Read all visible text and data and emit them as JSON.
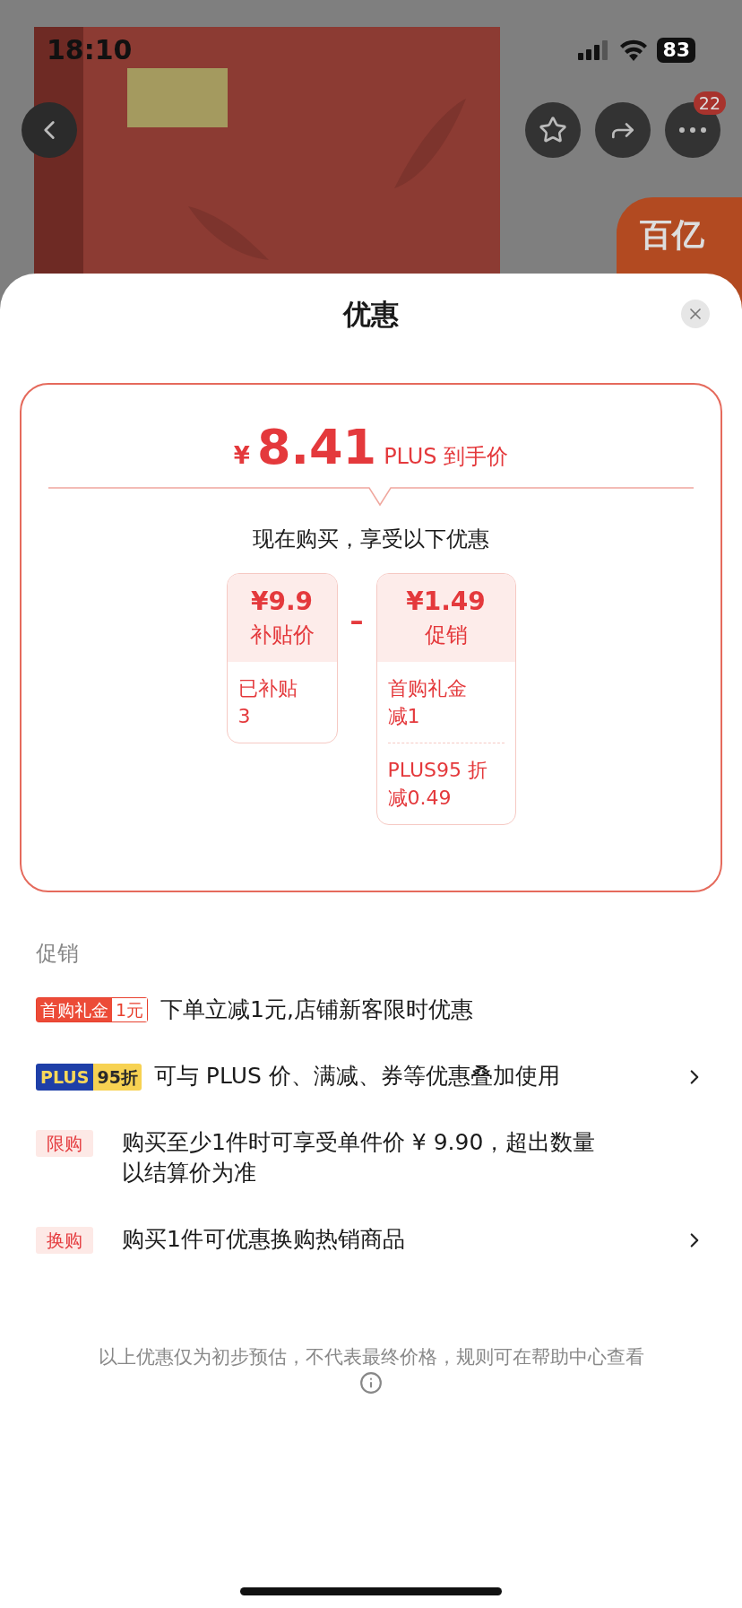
{
  "status_bar": {
    "time": "18:10",
    "battery": "83"
  },
  "nav": {
    "more_badge": "22"
  },
  "corner_badge": {
    "text": "百亿"
  },
  "sheet": {
    "title": "优惠"
  },
  "price": {
    "currency": "¥",
    "amount": "8.41",
    "label": "PLUS 到手价"
  },
  "subtitle": "现在购买，享受以下优惠",
  "breakdown": {
    "operator": "–",
    "boxes": [
      {
        "amount": "¥9.9",
        "label": "补贴价",
        "details": [
          [
            "已补贴",
            "3"
          ]
        ]
      },
      {
        "amount": "¥1.49",
        "label": "促销",
        "details": [
          [
            "首购礼金",
            "减1"
          ],
          [
            "PLUS95 折",
            "减0.49"
          ]
        ]
      }
    ]
  },
  "promotions": {
    "heading": "促销",
    "items": [
      {
        "kind": "gift",
        "tag": "首购礼金",
        "tag_value": "1元",
        "text": "下单立减1元,店铺新客限时优惠",
        "arrow": false
      },
      {
        "kind": "plus",
        "tag": "PLUS",
        "tag_value": "95折",
        "text": "可与 PLUS 价、满减、券等优惠叠加使用",
        "arrow": true
      },
      {
        "kind": "plain",
        "tag": "限购",
        "text": "购买至少1件时可享受单件价 ¥ 9.90，超出数量以结算价为准",
        "arrow": false
      },
      {
        "kind": "plain",
        "tag": "换购",
        "text": "购买1件可优惠换购热销商品",
        "arrow": true
      }
    ]
  },
  "footer": "以上优惠仅为初步预估，不代表最终价格，规则可在帮助中心查看"
}
